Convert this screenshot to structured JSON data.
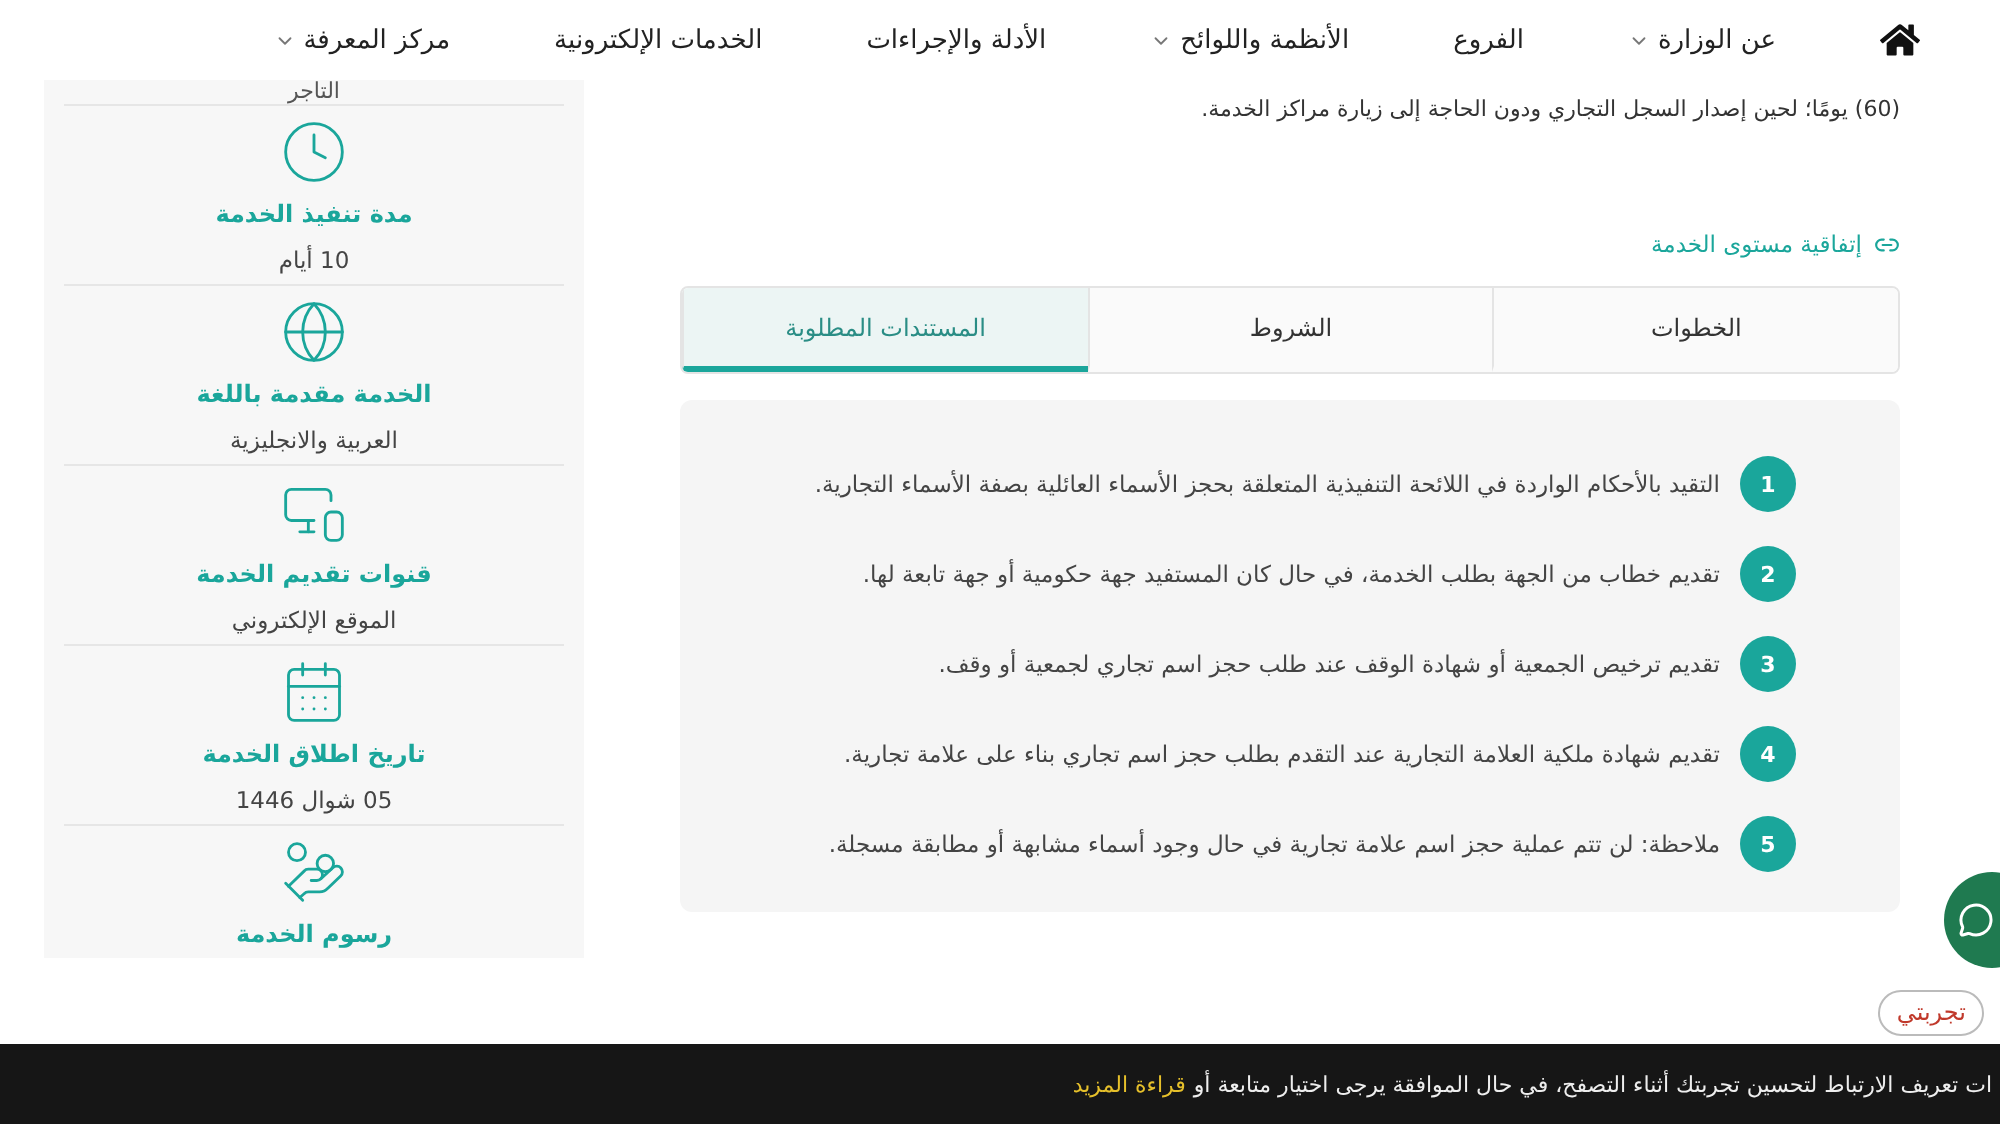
{
  "nav": {
    "items": [
      {
        "label": "عن الوزارة",
        "dropdown": true
      },
      {
        "label": "الفروع",
        "dropdown": false
      },
      {
        "label": "الأنظمة واللوائح",
        "dropdown": true
      },
      {
        "label": "الأدلة والإجراءات",
        "dropdown": false
      },
      {
        "label": "الخدمات الإلكترونية",
        "dropdown": false
      },
      {
        "label": "مركز المعرفة",
        "dropdown": true
      }
    ]
  },
  "sidebar": {
    "top_value": "التاجر",
    "items": [
      {
        "title": "مدة تنفيذ الخدمة",
        "value": "10 أيام"
      },
      {
        "title": "الخدمة مقدمة باللغة",
        "value": "العربية والانجليزية"
      },
      {
        "title": "قنوات تقديم الخدمة",
        "value": "الموقع الإلكتروني"
      },
      {
        "title": "تاريخ اطلاق الخدمة",
        "value": "05 شوال 1446"
      },
      {
        "title": "رسوم الخدمة"
      }
    ]
  },
  "intro": "(60) يومًا؛ لحين إصدار السجل التجاري ودون الحاجة إلى زيارة مراكز الخدمة.",
  "sla_link": "إتفاقية مستوى الخدمة",
  "tabs": [
    {
      "label": "الخطوات",
      "selected": false
    },
    {
      "label": "الشروط",
      "selected": false
    },
    {
      "label": "المستندات المطلوبة",
      "selected": true
    }
  ],
  "documents": [
    {
      "number": "1",
      "text": "التقيد بالأحكام الواردة في اللائحة التنفيذية المتعلقة بحجز الأسماء العائلية بصفة الأسماء التجارية."
    },
    {
      "number": "2",
      "text": "تقديم خطاب من الجهة بطلب الخدمة، في حال كان المستفيد جهة حكومية أو جهة تابعة لها."
    },
    {
      "number": "3",
      "text": "تقديم ترخيص الجمعية أو شهادة الوقف عند طلب حجز اسم تجاري لجمعية أو وقف."
    },
    {
      "number": "4",
      "text": "تقديم شهادة ملكية العلامة التجارية عند التقدم بطلب حجز اسم تجاري بناء على علامة تجارية."
    },
    {
      "number": "5",
      "text": "ملاحظة: لن تتم عملية حجز اسم علامة تجارية في حال وجود أسماء مشابهة أو مطابقة مسجلة."
    }
  ],
  "feedback_bubble": "تجربتي",
  "cookie_bar": {
    "text": "ات تعريف الارتباط لتحسين تجربتك أثناء التصفح، في حال الموافقة يرجى اختيار متابعة أو",
    "link": "قراءة المزيد"
  }
}
